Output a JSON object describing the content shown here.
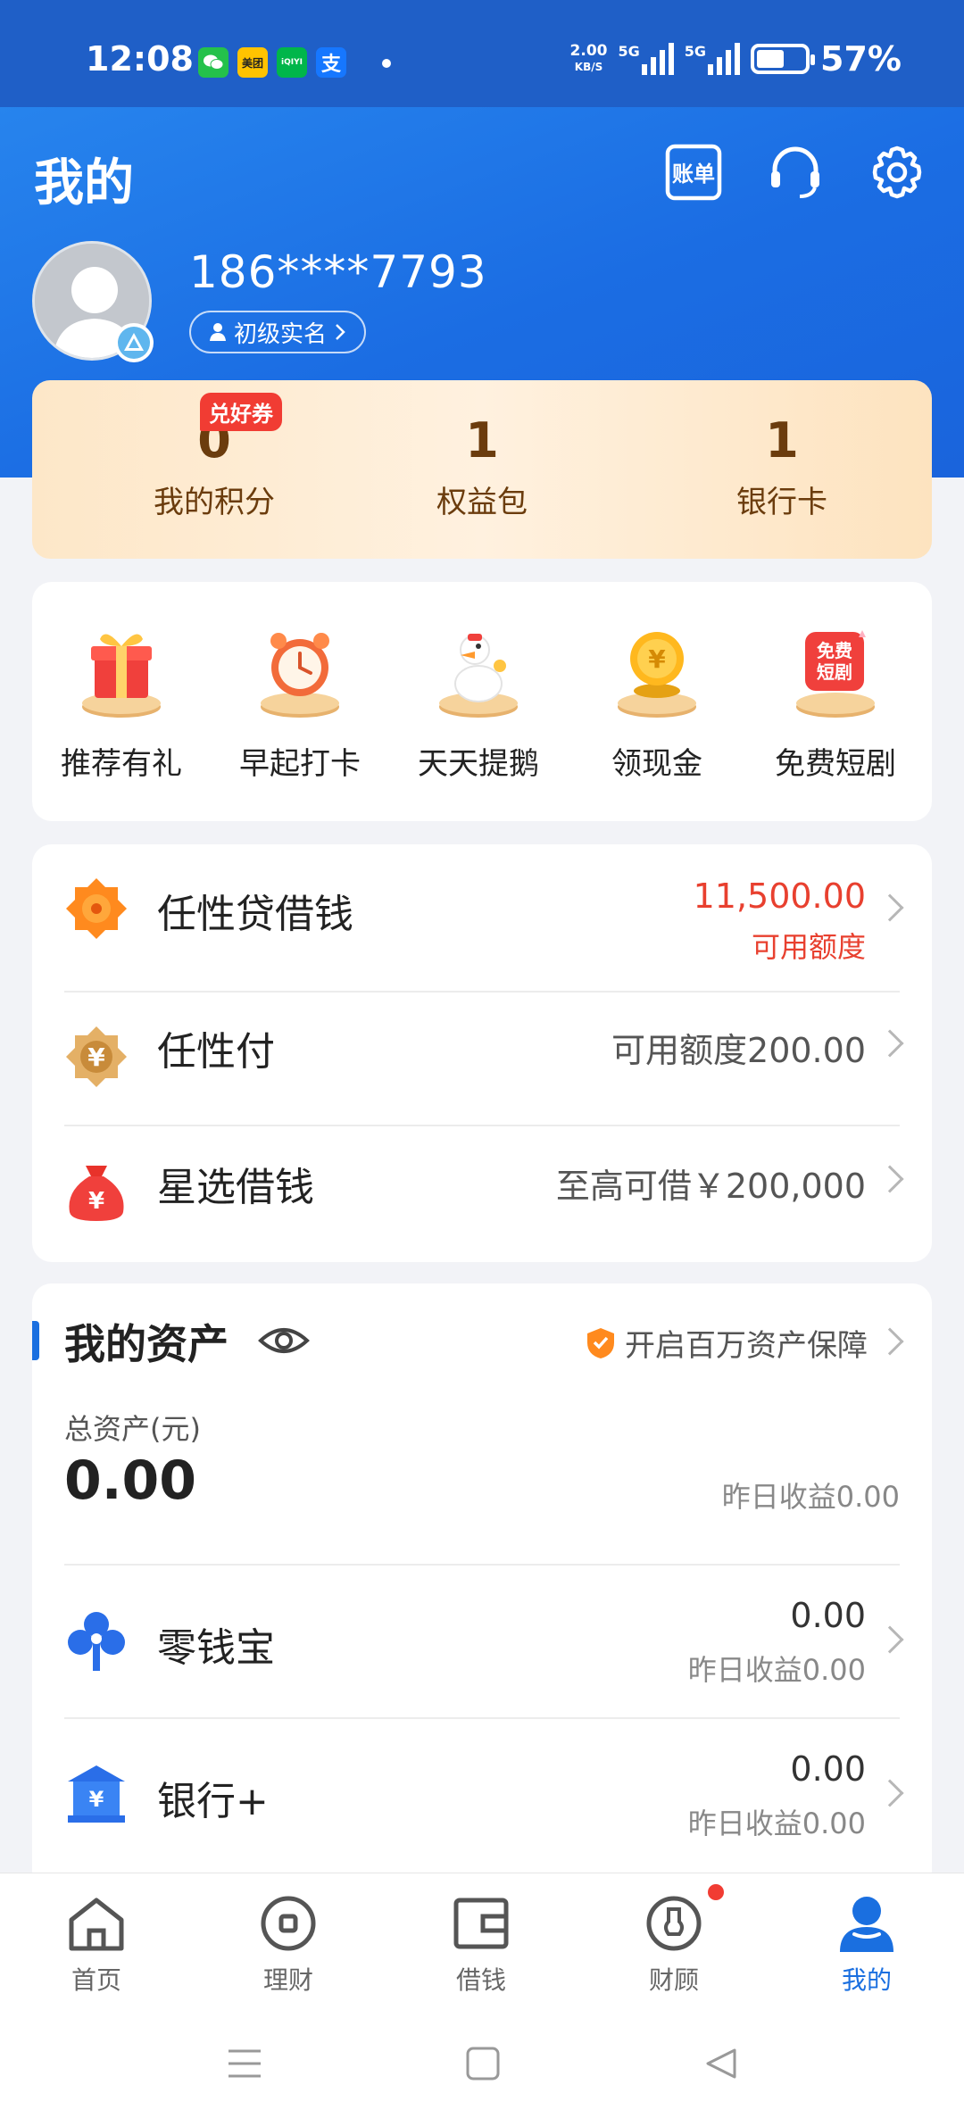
{
  "status_bar": {
    "time": "12:08",
    "apps": [
      {
        "name": "wechat",
        "glyph": "",
        "color": "#24c14b"
      },
      {
        "name": "meituan",
        "glyph": "美团",
        "color": "#ffc300"
      },
      {
        "name": "iqiyi",
        "glyph": "iQIYI",
        "color": "#00b64a"
      },
      {
        "name": "alipay",
        "glyph": "支",
        "color": "#1677ff"
      }
    ],
    "speed_value": "2.00",
    "speed_unit": "KB/S",
    "sim1": "5G",
    "sim2": "5G",
    "battery": "57%",
    "battery_level": 0.57
  },
  "header": {
    "title": "我的",
    "bill_label": "账单"
  },
  "profile": {
    "phone": "186****7793",
    "verify_label": "初级实名"
  },
  "stats": {
    "coupon_tag": "兑好券",
    "items": [
      {
        "value": "0",
        "label": "我的积分"
      },
      {
        "value": "1",
        "label": "权益包"
      },
      {
        "value": "1",
        "label": "银行卡"
      }
    ]
  },
  "quick_entries": [
    {
      "label": "推荐有礼",
      "icon": "gift-icon"
    },
    {
      "label": "早起打卡",
      "icon": "alarm-clock-icon"
    },
    {
      "label": "天天提鹅",
      "icon": "goose-icon"
    },
    {
      "label": "领现金",
      "icon": "gold-coin-icon"
    },
    {
      "label": "免费短剧",
      "icon": "short-drama-icon",
      "badge": "免费短剧"
    }
  ],
  "loans": {
    "items": [
      {
        "name": "任性贷借钱",
        "value": "11,500.00",
        "sub": "可用额度"
      },
      {
        "name": "任性付",
        "value": "可用额度200.00"
      },
      {
        "name": "星选借钱",
        "value": "至高可借￥200,000"
      }
    ]
  },
  "assets": {
    "title": "我的资产",
    "protect_label": "开启百万资产保障",
    "total_label": "总资产(元)",
    "total_value": "0.00",
    "yesterday_earn": "昨日收益0.00",
    "rows": [
      {
        "name": "零钱宝",
        "value": "0.00",
        "sub": "昨日收益0.00"
      },
      {
        "name": "银行+",
        "value": "0.00",
        "sub": "昨日收益0.00"
      }
    ]
  },
  "tabs": [
    {
      "label": "首页",
      "icon": "home-icon"
    },
    {
      "label": "理财",
      "icon": "finance-icon"
    },
    {
      "label": "借钱",
      "icon": "wallet-icon"
    },
    {
      "label": "财顾",
      "icon": "advisor-icon"
    },
    {
      "label": "我的",
      "icon": "user-icon"
    }
  ],
  "colors": {
    "brand_blue": "#1a6fe0",
    "amount_red": "#e8402f",
    "coupon_red": "#f13c33"
  }
}
